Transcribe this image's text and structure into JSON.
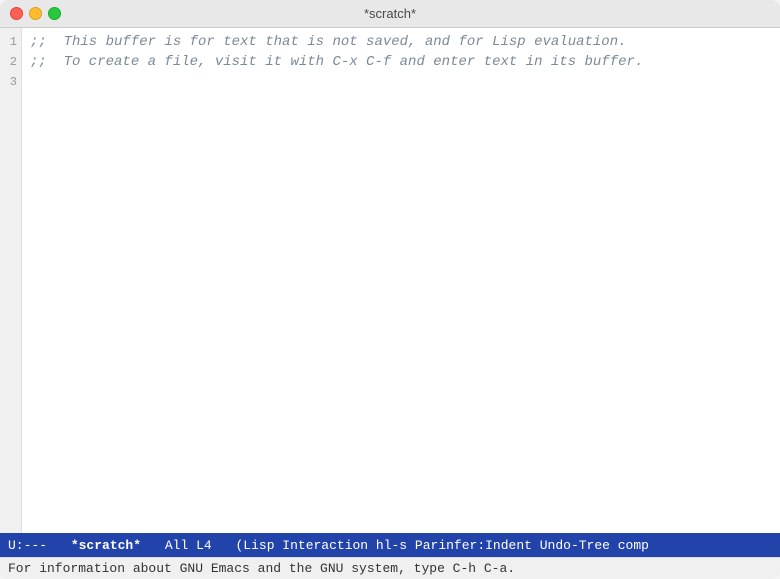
{
  "titlebar": {
    "title": "*scratch*"
  },
  "traffic_lights": {
    "close_label": "close",
    "minimize_label": "minimize",
    "maximize_label": "maximize"
  },
  "editor": {
    "lines": [
      {
        "number": "1",
        "content": ";;  This buffer is for text that is not saved, and for Lisp evaluation."
      },
      {
        "number": "2",
        "content": ";;  To create a file, visit it with C-x C-f and enter text in its buffer."
      },
      {
        "number": "3",
        "content": ""
      }
    ]
  },
  "modeline": {
    "status": "U:---",
    "buffername": "*scratch*",
    "position": "All L4",
    "mode": "(Lisp Interaction hl-s Parinfer:Indent Undo-Tree comp"
  },
  "echo_area": {
    "text": "For information about GNU Emacs and the GNU system, type C-h C-a."
  }
}
